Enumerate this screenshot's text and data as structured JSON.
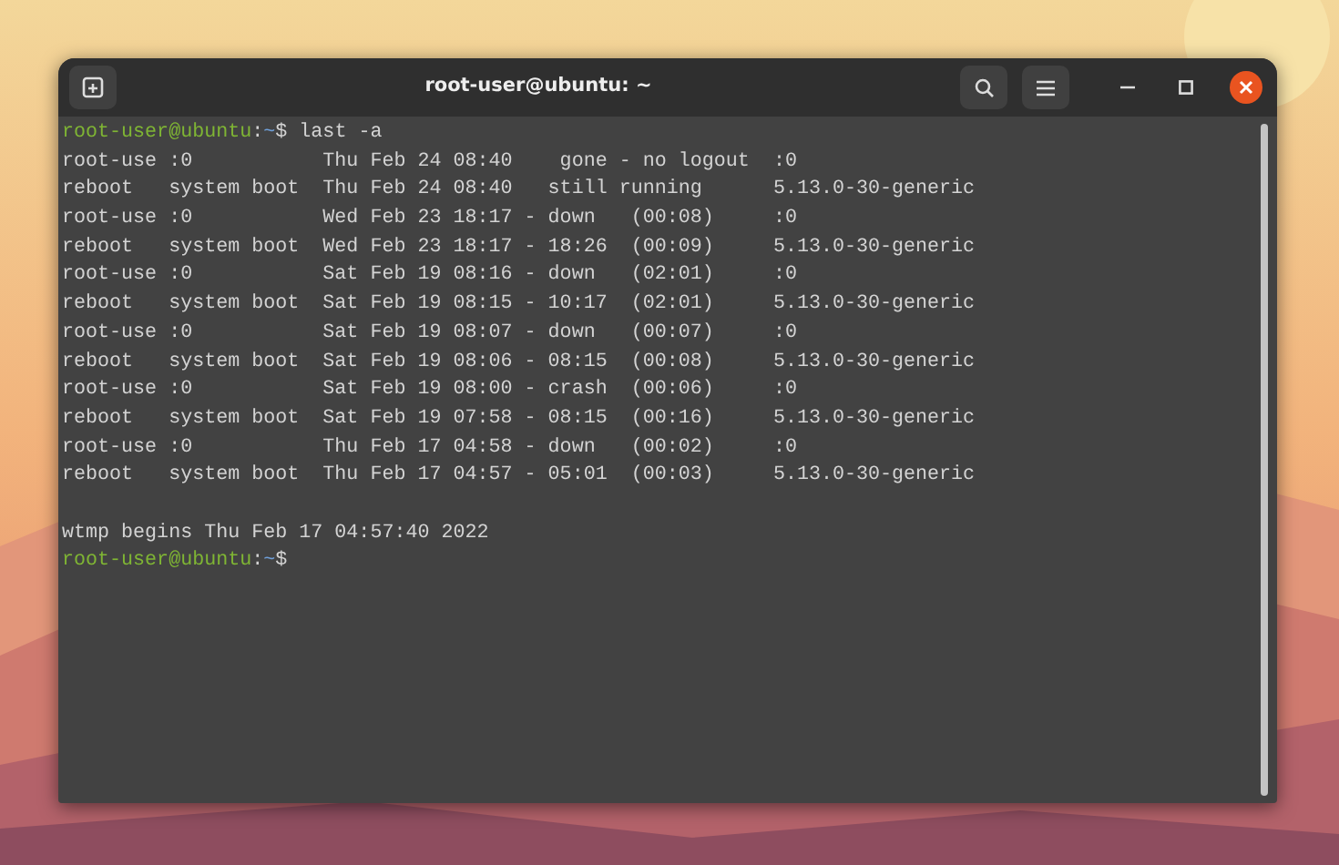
{
  "window": {
    "title": "root-user@ubuntu: ~"
  },
  "prompts": [
    {
      "user_host": "root-user@ubuntu",
      "separator": ":",
      "path": "~",
      "symbol": "$",
      "command": "last -a"
    }
  ],
  "output": [
    "root-use :0           Thu Feb 24 08:40    gone - no logout  :0",
    "reboot   system boot  Thu Feb 24 08:40   still running      5.13.0-30-generic",
    "root-use :0           Wed Feb 23 18:17 - down   (00:08)     :0",
    "reboot   system boot  Wed Feb 23 18:17 - 18:26  (00:09)     5.13.0-30-generic",
    "root-use :0           Sat Feb 19 08:16 - down   (02:01)     :0",
    "reboot   system boot  Sat Feb 19 08:15 - 10:17  (02:01)     5.13.0-30-generic",
    "root-use :0           Sat Feb 19 08:07 - down   (00:07)     :0",
    "reboot   system boot  Sat Feb 19 08:06 - 08:15  (00:08)     5.13.0-30-generic",
    "root-use :0           Sat Feb 19 08:00 - crash  (00:06)     :0",
    "reboot   system boot  Sat Feb 19 07:58 - 08:15  (00:16)     5.13.0-30-generic",
    "root-use :0           Thu Feb 17 04:58 - down   (00:02)     :0",
    "reboot   system boot  Thu Feb 17 04:57 - 05:01  (00:03)     5.13.0-30-generic"
  ],
  "summary": "wtmp begins Thu Feb 17 04:57:40 2022",
  "final_prompt": {
    "user_host": "root-user@ubuntu",
    "separator": ":",
    "path": "~",
    "symbol": "$"
  }
}
